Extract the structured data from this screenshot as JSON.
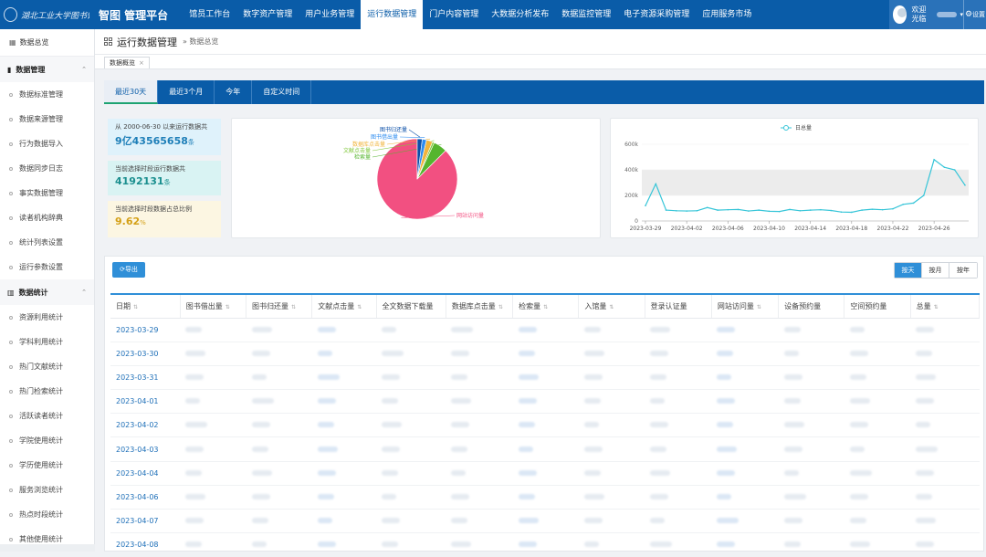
{
  "topbar": {
    "logo_text": "湖北工业大学图书馆",
    "app_title": "智图 管理平台",
    "nav": [
      "馆员工作台",
      "数字资产管理",
      "用户业务管理",
      "运行数据管理",
      "门户内容管理",
      "大数据分析发布",
      "数据监控管理",
      "电子资源采购管理",
      "应用服务市场"
    ],
    "active_nav": "运行数据管理",
    "user_welcome": "欢迎光临",
    "settings_label": "设置"
  },
  "sidebar": {
    "top_item": "数据总览",
    "groups": [
      {
        "label": "数据管理",
        "items": [
          "数据标准管理",
          "数据来源管理",
          "行为数据导入",
          "数据同步日志",
          "事实数据管理",
          "读者机构辞典",
          "统计列表设置",
          "运行参数设置"
        ]
      },
      {
        "label": "数据统计",
        "items": [
          "资源利用统计",
          "学科利用统计",
          "热门文献统计",
          "热门检索统计",
          "活跃读者统计",
          "学院使用统计",
          "学历使用统计",
          "服务浏览统计",
          "热点时段统计",
          "其他使用统计"
        ]
      }
    ]
  },
  "header": {
    "title": "运行数据管理",
    "breadcrumb": "» 数据总览",
    "open_tab": "数据概览",
    "open_tab_close": "×"
  },
  "period_tabs": [
    "最近30天",
    "最近3个月",
    "今年",
    "自定义时间"
  ],
  "active_period": "最近30天",
  "stats": [
    {
      "label": "从 2000-06-30 以来运行数据共",
      "value": "9亿43565658",
      "unit": "条"
    },
    {
      "label": "当前选择时段运行数据共",
      "value": "4192131",
      "unit": "条"
    },
    {
      "label": "当前选择时段数据占总比例",
      "value": "9.62",
      "unit": "%"
    }
  ],
  "chart_data": [
    {
      "type": "pie",
      "categories": [
        "网站访问量",
        "检索量",
        "文献点击量",
        "数据库点击量",
        "图书借出量",
        "图书归还量"
      ],
      "values": [
        87.5,
        5.5,
        0.8,
        2.5,
        1.7,
        2.0
      ],
      "colors": [
        "#f25081",
        "#55b52e",
        "#7fc73a",
        "#f1b43b",
        "#2d8cf0",
        "#0a4fa8"
      ]
    },
    {
      "type": "line",
      "series": [
        {
          "name": "日总量",
          "values": [
            120000,
            290000,
            85000,
            80000,
            78000,
            80000,
            105000,
            85000,
            88000,
            90000,
            78000,
            85000,
            76000,
            74000,
            90000,
            80000,
            85000,
            88000,
            82000,
            70000,
            68000,
            85000,
            92000,
            88000,
            95000,
            130000,
            140000,
            200000,
            480000,
            420000,
            400000,
            280000
          ]
        }
      ],
      "x": [
        "2023-03-29",
        "2023-04-02",
        "2023-04-06",
        "2023-04-10",
        "2023-04-14",
        "2023-04-18",
        "2023-04-22",
        "2023-04-26"
      ],
      "y_ticks": [
        "0",
        "200k",
        "400k",
        "600k"
      ],
      "ylim": [
        0,
        600000
      ],
      "band": [
        200000,
        400000
      ],
      "color": "#36c5d8",
      "legend": "top-center"
    }
  ],
  "table": {
    "export_label": "导出",
    "granularity": [
      "按天",
      "按月",
      "按年"
    ],
    "active_granularity": "按天",
    "columns": [
      "日期",
      "图书借出量",
      "图书归还量",
      "文献点击量",
      "全文数据下载量",
      "数据库点击量",
      "检索量",
      "入馆量",
      "登录认证量",
      "网站访问量",
      "设备预约量",
      "空间预约量",
      "总量"
    ],
    "sortable": [
      true,
      true,
      true,
      true,
      false,
      true,
      true,
      true,
      false,
      true,
      false,
      false,
      true
    ],
    "rows": [
      "2023-03-29",
      "2023-03-30",
      "2023-03-31",
      "2023-04-01",
      "2023-04-02",
      "2023-04-03",
      "2023-04-04",
      "2023-04-06",
      "2023-04-07",
      "2023-04-08"
    ]
  }
}
